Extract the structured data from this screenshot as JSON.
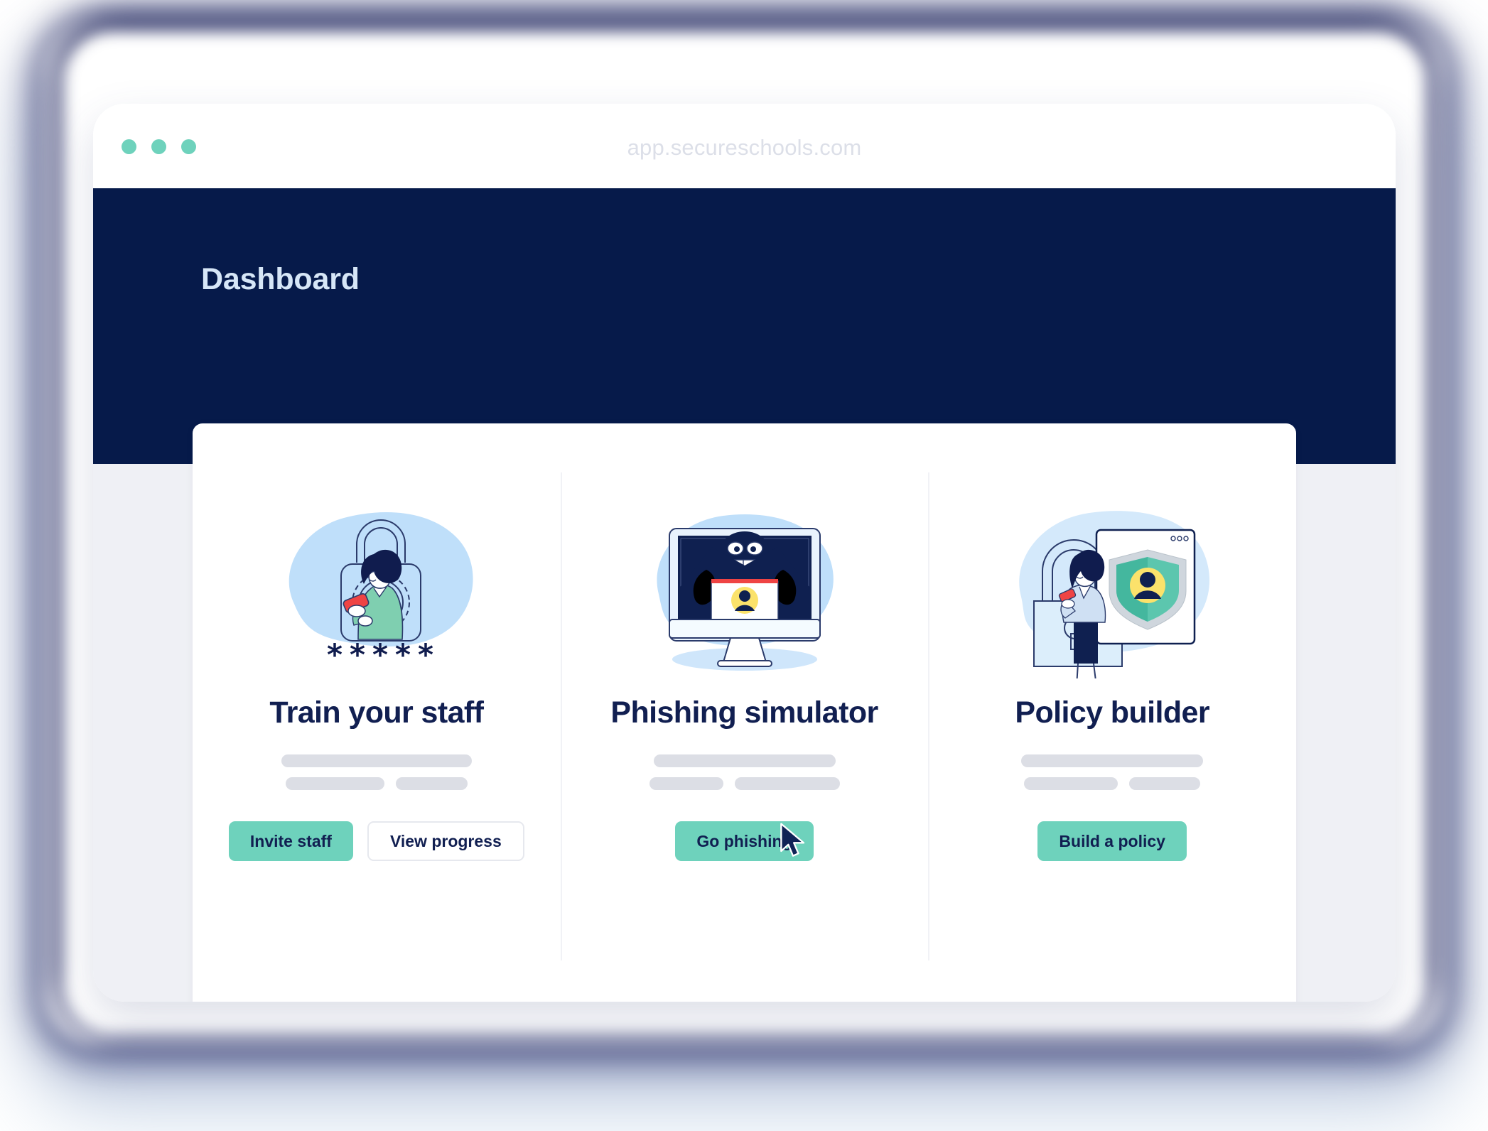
{
  "browser": {
    "address": "app.secureschools.com",
    "dots": [
      "window-dot-1",
      "window-dot-2",
      "window-dot-3"
    ],
    "dot_color": "#6ED2BC"
  },
  "app": {
    "header_color": "#061a4a",
    "page_title": "Dashboard",
    "background_color": "#eff0f5",
    "accent_color": "#6ED2BC",
    "text_color": "#111f51"
  },
  "features": [
    {
      "id": "train-your-staff",
      "title": "Train your staff",
      "illustration": "woman-phone-padlock-asterisks-illustration",
      "buttons": [
        {
          "id": "invite-staff",
          "label": "Invite staff",
          "style": "primary"
        },
        {
          "id": "view-progress",
          "label": "View progress",
          "style": "secondary"
        }
      ]
    },
    {
      "id": "phishing-simulator",
      "title": "Phishing simulator",
      "illustration": "monitor-hacker-stealing-credentials-illustration",
      "buttons": [
        {
          "id": "go-phishing",
          "label": "Go phishing",
          "style": "primary"
        }
      ]
    },
    {
      "id": "policy-builder",
      "title": "Policy builder",
      "illustration": "woman-shield-browser-padlock-illustration",
      "buttons": [
        {
          "id": "build-a-policy",
          "label": "Build a policy",
          "style": "primary"
        }
      ]
    }
  ],
  "cursor": {
    "name": "mouse-pointer",
    "over": "go-phishing"
  }
}
